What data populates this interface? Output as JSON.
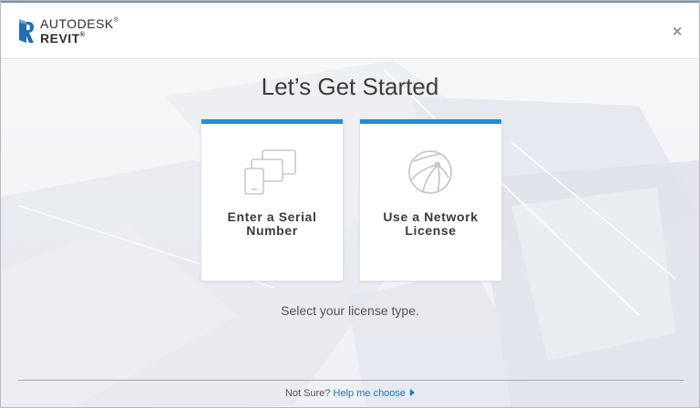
{
  "header": {
    "brand_line1": "AUTODESK",
    "brand_line2": "REVIT",
    "logo_icon": "revit-r-icon",
    "close_glyph": "×",
    "close_icon": "close-icon"
  },
  "main": {
    "title": "Let’s Get Started",
    "subtitle": "Select your license type.",
    "cards": [
      {
        "icon": "devices-icon",
        "label_line1": "Enter a Serial",
        "label_line2": "Number"
      },
      {
        "icon": "network-globe-icon",
        "label_line1": "Use a Network",
        "label_line2": "License"
      }
    ]
  },
  "footer": {
    "prompt": "Not Sure?",
    "link_text": "Help me choose",
    "link_icon": "triangle-right-icon"
  },
  "colors": {
    "accent_blue": "#1e90d6",
    "link_blue": "#1778c7",
    "logo_blue": "#1f6fb5",
    "text_dark": "#3c3c3c"
  }
}
